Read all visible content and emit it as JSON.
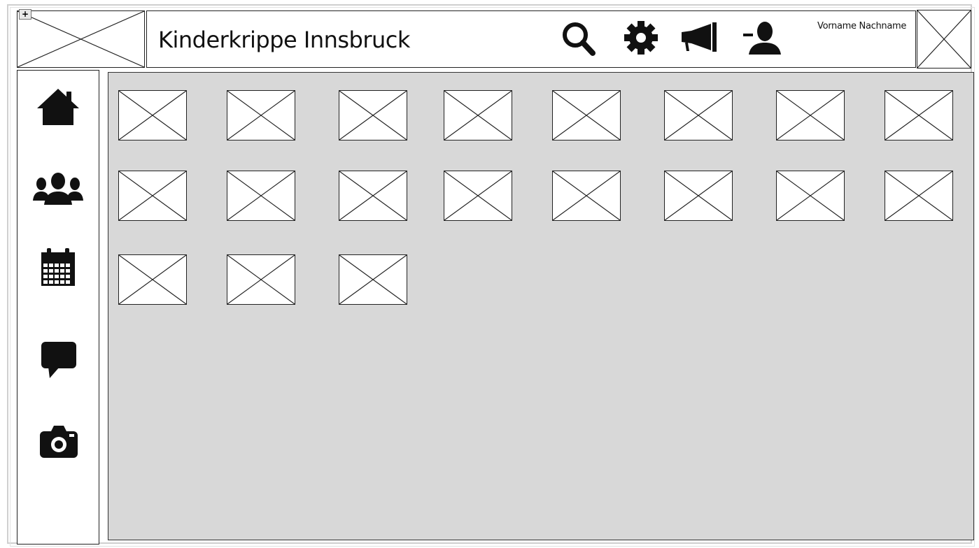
{
  "header": {
    "title": "Kinderkrippe Innsbruck",
    "user_name": "Vorname Nachname",
    "actions": [
      {
        "name": "search",
        "icon": "search-icon"
      },
      {
        "name": "settings",
        "icon": "gear-icon"
      },
      {
        "name": "announcements",
        "icon": "megaphone-icon"
      },
      {
        "name": "logout",
        "icon": "user-remove-icon"
      }
    ]
  },
  "toolbar": {
    "add_label": "+"
  },
  "sidebar": {
    "items": [
      {
        "name": "home",
        "icon": "home-icon"
      },
      {
        "name": "groups",
        "icon": "users-icon"
      },
      {
        "name": "calendar",
        "icon": "calendar-icon"
      },
      {
        "name": "messages",
        "icon": "chat-icon"
      },
      {
        "name": "photos",
        "icon": "camera-icon"
      }
    ]
  },
  "gallery": {
    "columns": 8,
    "rows": 3,
    "tile_count": 19
  },
  "colors": {
    "ink": "#111111",
    "content_bg": "#d8d8d8",
    "frame": "#cfcfcf"
  }
}
